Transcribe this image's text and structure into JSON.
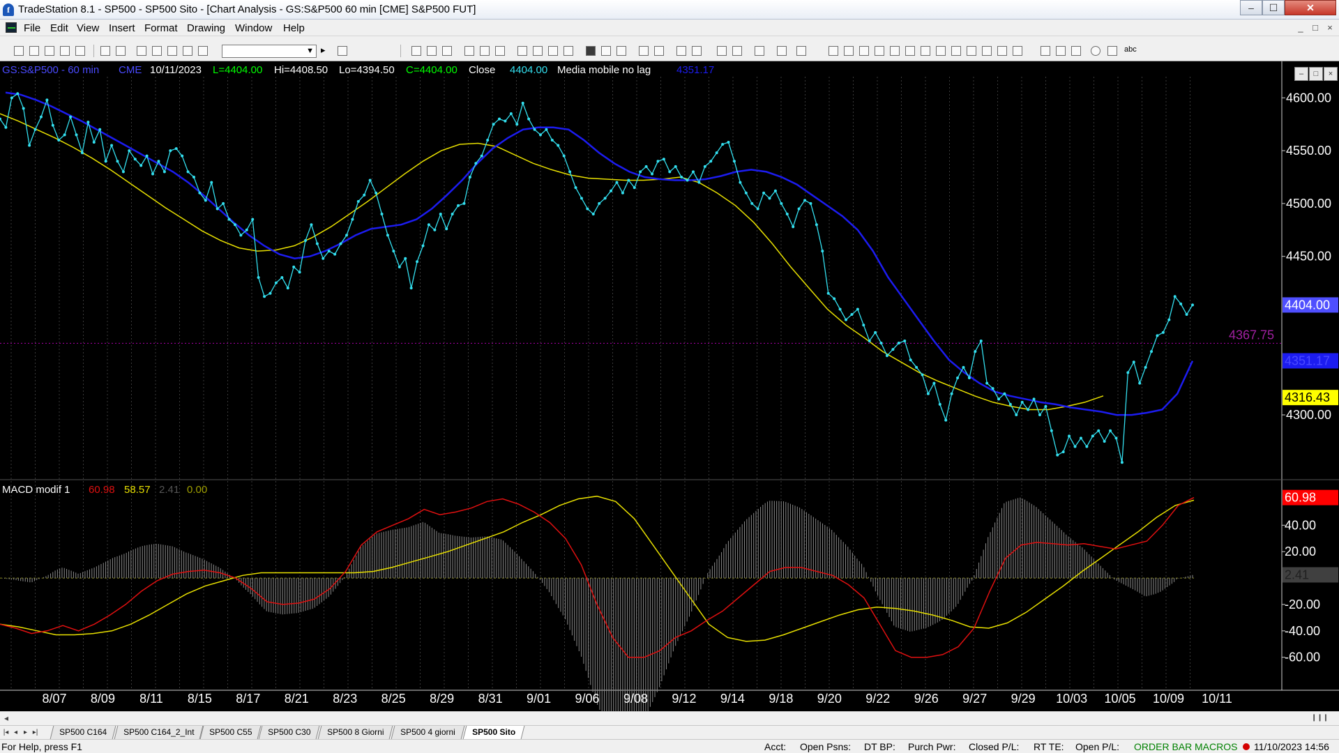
{
  "window": {
    "title": "TradeStation 8.1 - SP500 - SP500 Sito - [Chart Analysis - GS:S&P500  60 min  [CME] S&P500 FUT]",
    "app_icon_glyph": "f",
    "min_glyph": "–",
    "max_glyph": "☐",
    "close_glyph": "✕"
  },
  "menu": {
    "items": [
      "File",
      "Edit",
      "View",
      "Insert",
      "Format",
      "Drawing",
      "Window",
      "Help"
    ],
    "mdi_controls": [
      "_",
      "□",
      "×"
    ]
  },
  "toolbar": {
    "symbol_value": "",
    "dropdown_glyph": "▼",
    "scroll_glyph": "▸",
    "abc_label": "abc"
  },
  "chart": {
    "info": {
      "symbol": "GS:S&P500 - 60 min",
      "exchange": "CME",
      "date": "10/11/2023",
      "low": "L=4404.00",
      "high": "Hi=4408.50",
      "lo": "Lo=4394.50",
      "close_eq": "C=4404.00",
      "close_label": "Close",
      "close_value": "4404.00",
      "ma_label": "Media mobile no lag",
      "ma_value": "4351.17"
    },
    "macd_info": {
      "label": "MACD modif 1",
      "v1": "60.98",
      "v2": "58.57",
      "v3": "2.41",
      "v4": "0.00"
    },
    "window_controls": [
      "–",
      "□",
      "×"
    ],
    "colors": {
      "price": "#33e0f0",
      "ma_fast": "#1c1cf0",
      "ma_slow": "#e8e000",
      "macd_line": "#e01010",
      "signal": "#e8e000",
      "histogram": "#8c8c8c",
      "ref_line": "#b000b0"
    }
  },
  "chart_data": {
    "type": "line",
    "title": "GS:S&P500 - 60 min",
    "x_tick_labels": [
      "8/07",
      "8/09",
      "8/11",
      "8/15",
      "8/17",
      "8/21",
      "8/23",
      "8/25",
      "8/29",
      "8/31",
      "9/01",
      "9/06",
      "9/08",
      "9/12",
      "9/14",
      "9/18",
      "9/20",
      "9/22",
      "9/26",
      "9/27",
      "9/29",
      "10/03",
      "10/05",
      "10/09",
      "10/11"
    ],
    "price_axis": {
      "ticks": [
        "4600.00",
        "4550.00",
        "4500.00",
        "4450.00",
        "4300.00"
      ],
      "range": [
        4240,
        4620
      ],
      "labels": [
        {
          "value": 4404.0,
          "text": "4404.00"
        },
        {
          "value": 4351.17,
          "text": "4351.17"
        },
        {
          "value": 4316.43,
          "text": "4316.43"
        }
      ],
      "reference_line": {
        "value": 4367.75,
        "text": "4367.75"
      }
    },
    "series": [
      {
        "name": "Close",
        "values": [
          4580,
          4572,
          4600,
          4604,
          4590,
          4555,
          4570,
          4582,
          4598,
          4574,
          4560,
          4565,
          4582,
          4565,
          4548,
          4577,
          4558,
          4570,
          4540,
          4555,
          4540,
          4530,
          4550,
          4542,
          4536,
          4545,
          4528,
          4540,
          4530,
          4550,
          4552,
          4545,
          4530,
          4525,
          4510,
          4503,
          4520,
          4495,
          4500,
          4485,
          4480,
          4470,
          4475,
          4485,
          4430,
          4412,
          4415,
          4425,
          4430,
          4420,
          4440,
          4435,
          4465,
          4480,
          4462,
          4448,
          4455,
          4452,
          4462,
          4470,
          4485,
          4502,
          4508,
          4522,
          4510,
          4490,
          4470,
          4455,
          4440,
          4448,
          4420,
          4445,
          4460,
          4480,
          4475,
          4490,
          4476,
          4490,
          4498,
          4500,
          4525,
          4538,
          4545,
          4560,
          4575,
          4580,
          4578,
          4585,
          4575,
          4595,
          4580,
          4570,
          4565,
          4570,
          4560,
          4555,
          4545,
          4530,
          4515,
          4505,
          4495,
          4490,
          4500,
          4505,
          4512,
          4520,
          4510,
          4522,
          4515,
          4530,
          4535,
          4528,
          4540,
          4542,
          4530,
          4535,
          4525,
          4522,
          4530,
          4520,
          4535,
          4540,
          4548,
          4556,
          4558,
          4540,
          4520,
          4510,
          4500,
          4495,
          4510,
          4505,
          4512,
          4500,
          4490,
          4478,
          4495,
          4503,
          4500,
          4480,
          4455,
          4415,
          4410,
          4400,
          4390,
          4395,
          4400,
          4385,
          4370,
          4378,
          4368,
          4356,
          4362,
          4368,
          4370,
          4352,
          4345,
          4338,
          4320,
          4330,
          4310,
          4295,
          4320,
          4335,
          4345,
          4335,
          4360,
          4370,
          4330,
          4325,
          4315,
          4320,
          4310,
          4300,
          4312,
          4305,
          4315,
          4300,
          4308,
          4285,
          4262,
          4265,
          4280,
          4270,
          4278,
          4270,
          4280,
          4285,
          4275,
          4285,
          4278,
          4255,
          4340,
          4350,
          4330,
          4345,
          4360,
          4375,
          4378,
          4390,
          4412,
          4405,
          4395,
          4404
        ]
      },
      {
        "name": "Media mobile no lag",
        "values": [
          4605,
          4603,
          4598,
          4592,
          4585,
          4578,
          4570,
          4562,
          4554,
          4546,
          4538,
          4530,
          4520,
          4508,
          4495,
          4482,
          4470,
          4460,
          4452,
          4448,
          4450,
          4455,
          4462,
          4470,
          4476,
          4478,
          4480,
          4485,
          4495,
          4508,
          4522,
          4538,
          4552,
          4562,
          4570,
          4572,
          4572,
          4570,
          4560,
          4548,
          4538,
          4530,
          4525,
          4523,
          4522,
          4522,
          4523,
          4526,
          4530,
          4532,
          4530,
          4525,
          4518,
          4508,
          4498,
          4488,
          4475,
          4455,
          4430,
          4410,
          4390,
          4370,
          4352,
          4340,
          4330,
          4322,
          4318,
          4315,
          4312,
          4310,
          4307,
          4305,
          4303,
          4300,
          4300,
          4302,
          4305,
          4320,
          4351
        ]
      },
      {
        "name": "Slow average",
        "values": [
          4585,
          4578,
          4570,
          4562,
          4553,
          4543,
          4532,
          4520,
          4508,
          4496,
          4485,
          4474,
          4465,
          4458,
          4455,
          4456,
          4460,
          4468,
          4478,
          4490,
          4502,
          4515,
          4528,
          4540,
          4550,
          4556,
          4557,
          4554,
          4546,
          4538,
          4532,
          4527,
          4524,
          4523,
          4522,
          4522,
          4523,
          4525,
          4520,
          4510,
          4498,
          4482,
          4462,
          4440,
          4420,
          4400,
          4385,
          4373,
          4360,
          4350,
          4340,
          4332,
          4325,
          4318,
          4312,
          4308,
          4305,
          4305,
          4308,
          4312,
          4318
        ]
      }
    ],
    "macd_panel": {
      "label": "MACD modif 1",
      "ticks": [
        "40.00",
        "20.00",
        "-20.00",
        "-40.00",
        "-60.00"
      ],
      "range": [
        -85,
        65
      ],
      "values_shown": {
        "macd": 60.98,
        "signal": 58.57,
        "histogram": 2.41,
        "zero": 0.0
      },
      "macd": [
        -35,
        -38,
        -42,
        -40,
        -36,
        -40,
        -35,
        -28,
        -20,
        -10,
        -2,
        3,
        5,
        6,
        4,
        0,
        -8,
        -18,
        -20,
        -19,
        -16,
        -8,
        5,
        25,
        35,
        40,
        45,
        52,
        48,
        50,
        53,
        58,
        60,
        56,
        50,
        42,
        30,
        10,
        -20,
        -45,
        -60,
        -60,
        -55,
        -45,
        -40,
        -32,
        -25,
        -15,
        -5,
        5,
        8,
        8,
        5,
        2,
        -5,
        -15,
        -35,
        -55,
        -60,
        -60,
        -58,
        -52,
        -38,
        -10,
        15,
        25,
        27,
        26,
        25,
        26,
        24,
        22,
        25,
        28,
        40,
        55,
        61
      ],
      "signal": [
        -35,
        -37,
        -40,
        -43,
        -43,
        -42,
        -40,
        -35,
        -28,
        -20,
        -12,
        -6,
        -2,
        2,
        4,
        4,
        4,
        4,
        4,
        4,
        5,
        8,
        12,
        16,
        20,
        25,
        30,
        35,
        42,
        48,
        55,
        60,
        62,
        58,
        45,
        25,
        5,
        -15,
        -35,
        -45,
        -48,
        -47,
        -43,
        -38,
        -33,
        -28,
        -24,
        -22,
        -23,
        -25,
        -28,
        -32,
        -37,
        -38,
        -34,
        -26,
        -16,
        -6,
        5,
        15,
        25,
        35,
        46,
        55,
        59
      ]
    }
  },
  "hscroll": {
    "left": "◂",
    "right": "❙❙❙"
  },
  "tabs": {
    "nav": [
      "|◂",
      "◂",
      "▸",
      "▸|"
    ],
    "items": [
      "SP500 C164",
      "SP500 C164_2_Int",
      "SP500 C55",
      "SP500 C30",
      "SP500 8 Giorni",
      "SP500 4 giorni",
      "SP500 Sito"
    ],
    "active_index": 6
  },
  "status": {
    "help": "For Help, press F1",
    "acct": "Acct:",
    "open_psns": "Open Psns:",
    "dt_bp": "DT BP:",
    "purch_pwr": "Purch Pwr:",
    "closed_pl": "Closed P/L:",
    "rt_te": "RT TE:",
    "open_pl": "Open P/L:",
    "order_bar": "ORDER BAR",
    "macros": "MACROS",
    "datetime": "11/10/2023 14:56"
  }
}
